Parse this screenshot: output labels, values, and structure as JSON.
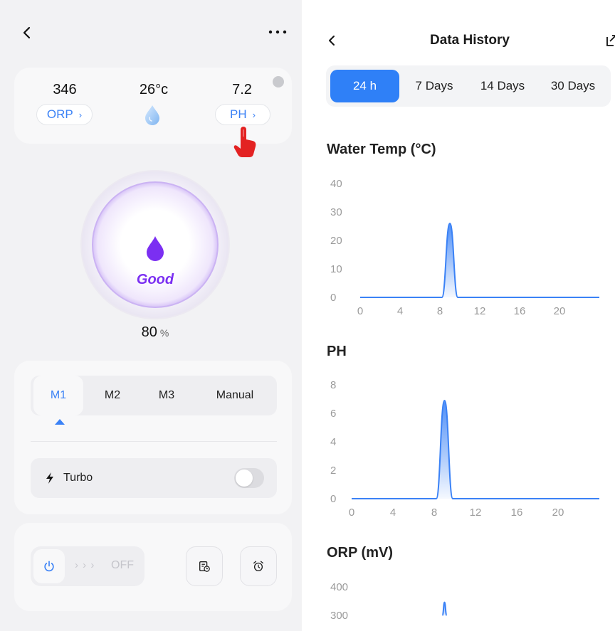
{
  "left": {
    "readings": [
      {
        "value": "346",
        "label": "ORP",
        "chevron": "›"
      },
      {
        "value": "26°c",
        "icon": "water-drop-icon"
      },
      {
        "value": "7.2",
        "label": "PH",
        "chevron": "›"
      }
    ],
    "gauge": {
      "status": "Good",
      "percent": "80",
      "percent_unit": "%",
      "level": 0.8,
      "color": "#7b2ff2"
    },
    "modes": {
      "tabs": [
        "M1",
        "M2",
        "M3",
        "Manual"
      ],
      "active": "M1"
    },
    "turbo": {
      "label": "Turbo",
      "enabled": false
    },
    "power": {
      "arrows": "› › ›",
      "state_label": "OFF"
    }
  },
  "right": {
    "title": "Data History",
    "ranges": [
      "24 h",
      "7 Days",
      "14 Days",
      "30 Days"
    ],
    "active_range": "24 h",
    "accent": "#2f80f7"
  },
  "chart_data": [
    {
      "type": "area",
      "title": "Water Temp (°C)",
      "x": [
        0,
        8.2,
        9,
        9.8,
        24
      ],
      "y": [
        0,
        0,
        26,
        0,
        0
      ],
      "xticks": [
        "0",
        "4",
        "8",
        "12",
        "16",
        "20"
      ],
      "yticks": [
        "40",
        "30",
        "20",
        "10",
        "0"
      ],
      "ylim": [
        0,
        40
      ],
      "grid": false,
      "color": "#3b82f6"
    },
    {
      "type": "area",
      "title": "PH",
      "x": [
        0,
        8.2,
        9,
        9.8,
        24
      ],
      "y": [
        0,
        0,
        6.9,
        0,
        0
      ],
      "xticks": [
        "0",
        "4",
        "8",
        "12",
        "16",
        "20"
      ],
      "yticks": [
        "8",
        "6",
        "4",
        "2",
        "0"
      ],
      "ylim": [
        0,
        8
      ],
      "grid": false,
      "color": "#3b82f6"
    },
    {
      "type": "area",
      "title": "ORP (mV)",
      "x": [
        8.8,
        9,
        9.2
      ],
      "y": [
        300,
        346,
        300
      ],
      "xticks": [],
      "yticks": [
        "400",
        "300"
      ],
      "ylim": [
        300,
        400
      ],
      "grid": false,
      "color": "#3b82f6"
    }
  ]
}
